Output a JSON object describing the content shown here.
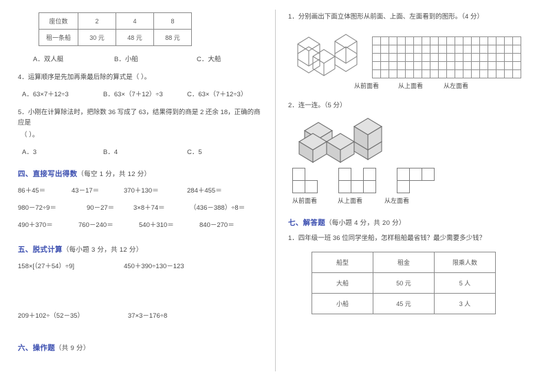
{
  "left": {
    "seat_table": {
      "rows": [
        {
          "label": "座位数",
          "cells": [
            "2",
            "4",
            "8"
          ]
        },
        {
          "label": "租一条船",
          "cells": [
            "30 元",
            "48 元",
            "88 元"
          ]
        }
      ]
    },
    "q3_options": [
      "A．双人艇",
      "B．小船",
      "C．大船"
    ],
    "q4": {
      "text": "4．运算顺序是先加再乘最后除的算式是（      ）。",
      "options": [
        "A．63×7＋12÷3",
        "B．63×（7＋12）÷3",
        "C．63×（7＋12÷3）"
      ]
    },
    "q5": {
      "text": "5．小刚在计算除法时，把除数 36 写成了 63，结果得到的商是 2 还余 18，正确的商应是",
      "text2": "（      ）。",
      "options": [
        "A．3",
        "B．4",
        "C．5"
      ]
    },
    "sec4": {
      "title": "四、直接写出得数",
      "points": "（每空 1 分，共 12 分）",
      "rows": [
        [
          "86＋45＝",
          "43－17＝",
          "370＋130＝",
          "284＋455＝"
        ],
        [
          "980－72÷9＝",
          "90－27＝",
          "3×8＋74＝",
          "（436－388）÷8＝"
        ],
        [
          "490＋370＝",
          "760－240＝",
          "540＋310＝",
          "840－270＝"
        ]
      ]
    },
    "sec5": {
      "title": "五、脱式计算",
      "points": "（每小题 3 分，共 12 分）",
      "rows": [
        [
          "158×[（27＋54）÷9]",
          "450＋390÷130－123"
        ],
        [
          "209＋102÷（52－35）",
          "37×3－176÷8"
        ]
      ]
    },
    "sec6": {
      "title": "六、操作题",
      "points": "（共 9 分）"
    }
  },
  "right": {
    "q1": "1．分别画出下面立体图形从前面、上面、左面看到的图形。（4 分）",
    "q1_grid": {
      "cols": 18,
      "rows": 5
    },
    "q1_labels": [
      "从前面看",
      "从上面看",
      "从左面看"
    ],
    "q2": "2．连一连。（5 分）",
    "q2_labels": [
      "从前面看",
      "从上面看",
      "从左面看"
    ],
    "sec7": {
      "title": "七、解答题",
      "points": "（每小题 4 分，共 20 分）",
      "q1": "1．四年级一班 36 位同学坐船，怎样租船最省钱？最少需要多少钱？"
    },
    "boat_table": {
      "header": [
        "船型",
        "租金",
        "限乘人数"
      ],
      "rows": [
        [
          "大船",
          "50 元",
          "5 人"
        ],
        [
          "小船",
          "45 元",
          "3 人"
        ]
      ]
    }
  },
  "colors": {
    "heading": "#3c4fb0",
    "text": "#4a4a4a",
    "line": "#8a8a8a",
    "cube_fill": "#d6d6d6"
  }
}
